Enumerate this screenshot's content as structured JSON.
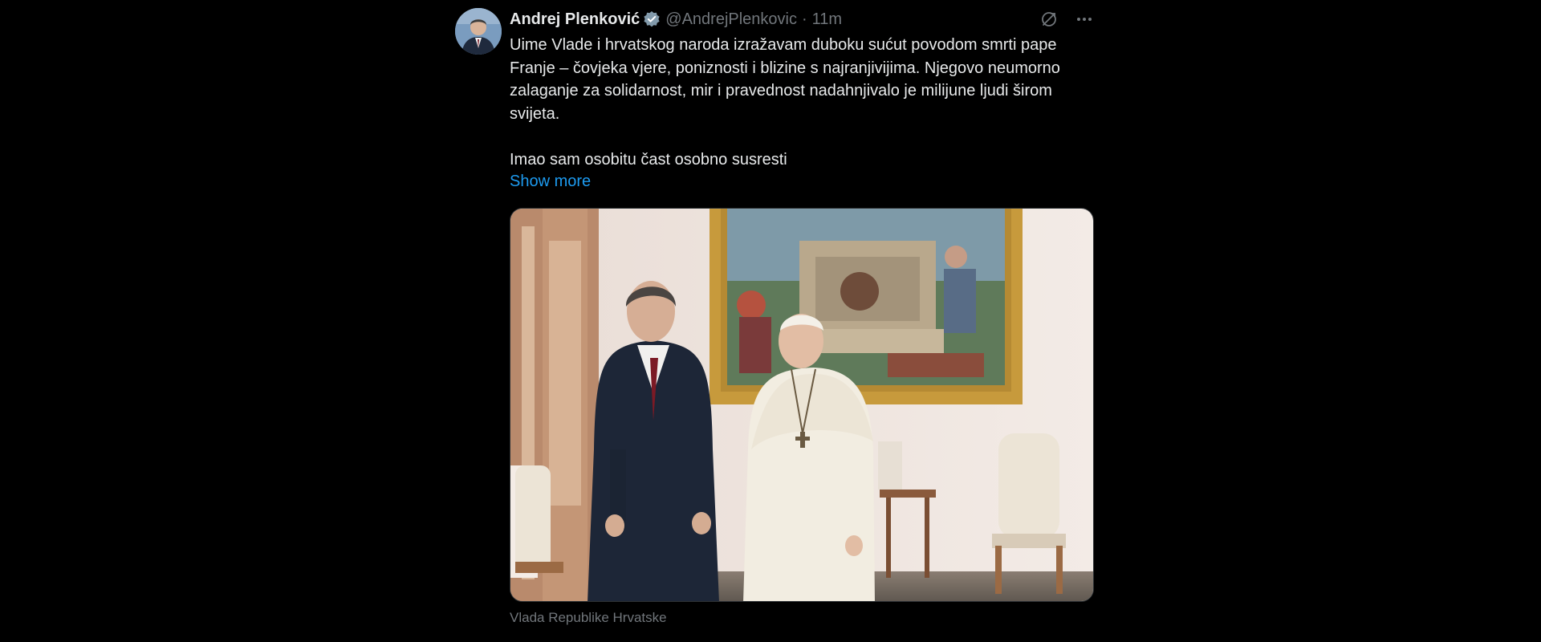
{
  "tweet": {
    "author_name": "Andrej Plenković",
    "handle": "@AndrejPlenkovic",
    "separator": "·",
    "time": "11m",
    "verified_icon": "verified-badge-icon",
    "text": "Uime Vlade i hrvatskog naroda izražavam duboku sućut povodom smrti pape Franje – čovjeka vjere, poniznosti i blizine s najranjivijima. Njegovo neumorno zalaganje za solidarnost, mir i pravednost nadahnjivalo je milijune ljudi širom svijeta.\n\nImao sam osobitu čast osobno susresti",
    "show_more": "Show more",
    "media_caption": "Vlada Republike Hrvatske",
    "actions": {
      "grok_icon": "grok-icon",
      "more_icon": "more-options-icon"
    }
  },
  "colors": {
    "background": "#000000",
    "text": "#e7e9ea",
    "secondary": "#71767b",
    "link": "#1d9bf0"
  }
}
